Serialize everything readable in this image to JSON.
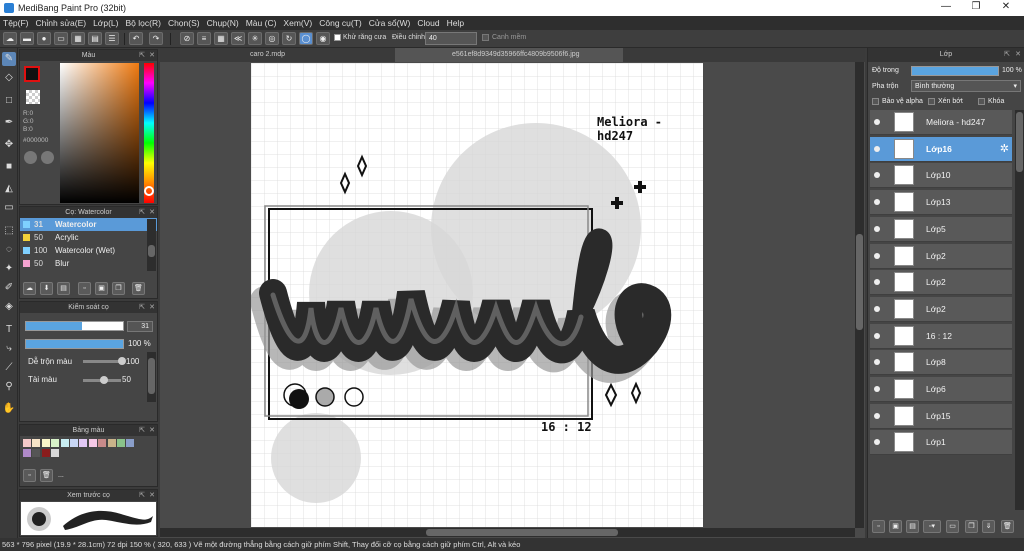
{
  "window": {
    "title": "MediBang Paint Pro (32bit)"
  },
  "menu": [
    "Tệp(F)",
    "Chỉnh sửa(E)",
    "Lớp(L)",
    "Bộ lọc(R)",
    "Chọn(S)",
    "Chụp(N)",
    "Màu (C)",
    "Xem(V)",
    "Công cụ(T)",
    "Cửa sổ(W)",
    "Cloud",
    "Help"
  ],
  "toolbar": {
    "antialias_label": "Khử răng cưa",
    "adjust_label": "Điều chỉnh",
    "adjust_value": "40",
    "snap_label": "Canh mềm"
  },
  "panels": {
    "color": {
      "title": "Màu",
      "r": "R:0",
      "g": "G:0",
      "b": "B:0",
      "hex": "#000000"
    },
    "brush": {
      "title": "Cọ: Watercolor",
      "items": [
        {
          "size": "31",
          "name": "Watercolor",
          "color": "#7fd0ff"
        },
        {
          "size": "50",
          "name": "Acrylic",
          "color": "#f2d23a"
        },
        {
          "size": "100",
          "name": "Watercolor (Wet)",
          "color": "#7fd0ff"
        },
        {
          "size": "50",
          "name": "Blur",
          "color": "#f5a3d0"
        }
      ]
    },
    "brush_control": {
      "title": "Kiểm soát cọ",
      "size_value": "31",
      "opacity_value": "100 %",
      "mix_label": "Dễ trộn màu",
      "mix_value": "100",
      "amount_label": "Tài màu",
      "amount_value": "50"
    },
    "palette": {
      "title": "Bảng màu",
      "ellipsis": "...",
      "colors": [
        "#f4c9c9",
        "#f6e3c6",
        "#f9f6c8",
        "#d8f2c8",
        "#c8eef2",
        "#c8d6f5",
        "#e2c8f5",
        "#f5c8e6",
        "#c88a8a",
        "#c9b38a",
        "#8ac28a",
        "#8a9ec9",
        "#b08ac9",
        "#555555",
        "#8a1d1d",
        "#d9d9d9"
      ]
    },
    "preview": {
      "title": "Xem trước cọ"
    }
  },
  "tabs": {
    "file1": "caro 2.mdp",
    "file2": "e561ef8d9349d35966ffc4809b9506f6.jpg"
  },
  "canvas_text": {
    "title": "Meliora - hd247",
    "time": "16 : 12"
  },
  "layers": {
    "title": "Lớp",
    "opacity_label": "Độ trong",
    "opacity_value": "100 %",
    "opacity_fraction": 1.0,
    "blend_label": "Pha trộn",
    "blend_value": "Bình thường",
    "protect_alpha": "Bảo vệ alpha",
    "clip": "Xén bớt",
    "lock": "Khóa",
    "items": [
      "Meliora - hd247",
      "Lớp16",
      "Lớp10",
      "Lớp13",
      "Lớp5",
      "Lớp2",
      "Lớp2",
      "Lớp2",
      "16 : 12",
      "Lớp8",
      "Lớp6",
      "Lớp15",
      "Lớp1"
    ],
    "selected": "Lớp16"
  },
  "status": "563 * 796 pixel   (19.9 * 28.1cm)   72 dpi   150 %   ( 320, 633 )   Vẽ một đường thẳng bằng cách giữ phím Shift, Thay đổi cỡ cọ bằng cách giữ phím Ctrl, Alt và kéo"
}
